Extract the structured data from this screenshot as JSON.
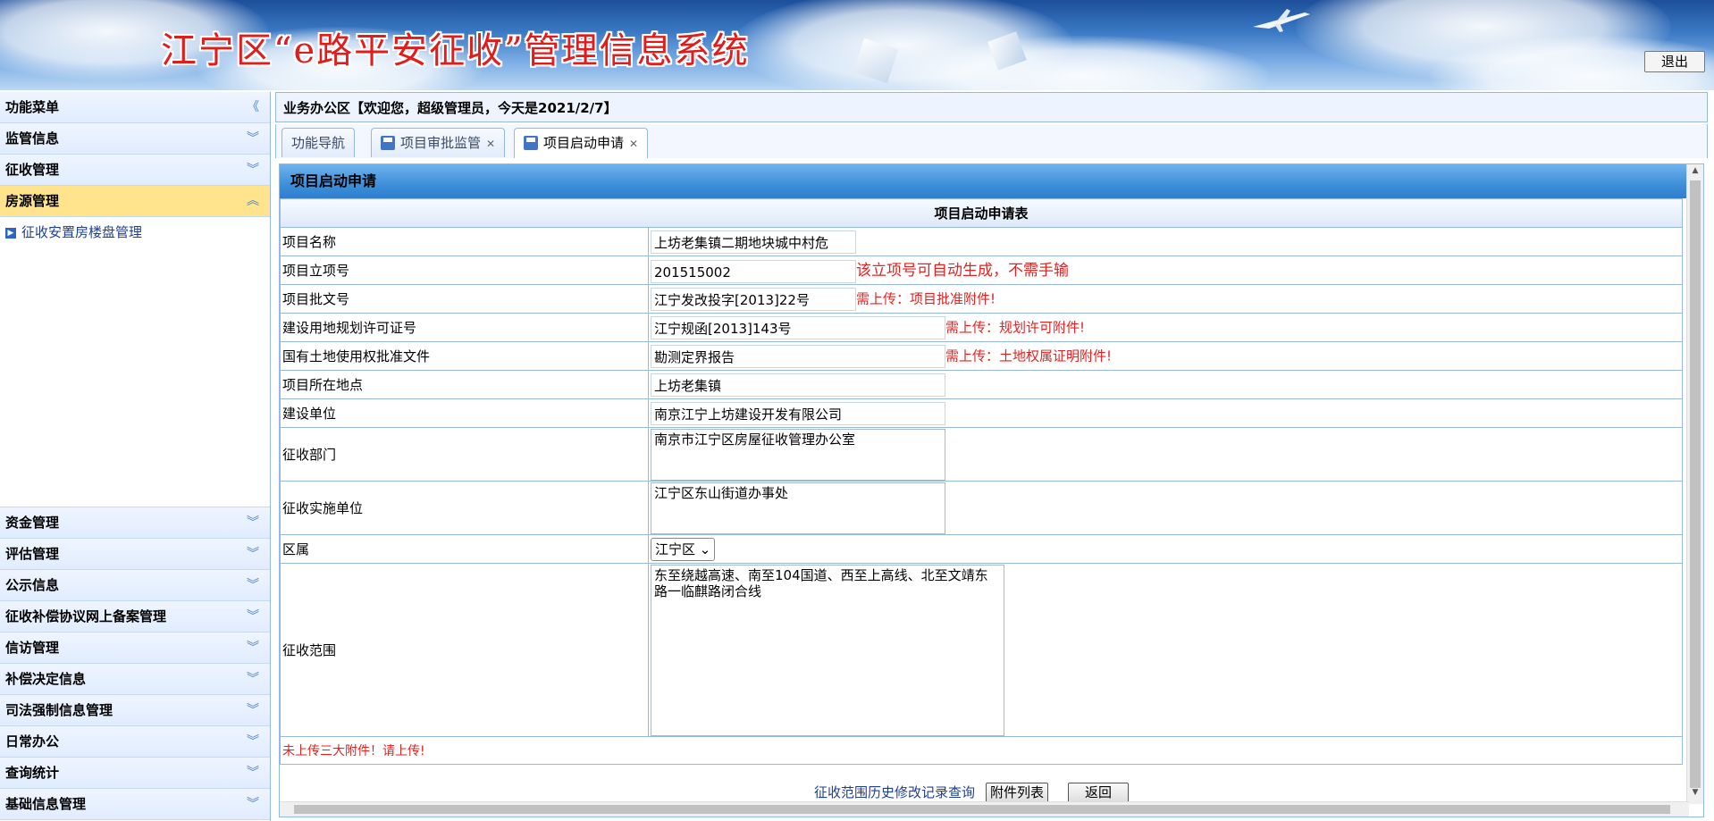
{
  "header": {
    "title": "江宁区“e路平安征收”管理信息系统",
    "logout": "退出"
  },
  "sidebar": {
    "menu_header": "功能菜单",
    "menu_header_icon": "double-chevron-left-icon",
    "sections_top": [
      "监管信息",
      "征收管理"
    ],
    "active_section": "房源管理",
    "active_item": "征收安置房楼盘管理",
    "sections_bottom": [
      "资金管理",
      "评估管理",
      "公示信息",
      "征收补偿协议网上备案管理",
      "信访管理",
      "补偿决定信息",
      "司法强制信息管理",
      "日常办公",
      "查询统计",
      "基础信息管理"
    ]
  },
  "office_bar": {
    "text": "业务办公区【欢迎您，超级管理员，今天是2021/2/7】"
  },
  "tabs": [
    {
      "label": "功能导航"
    },
    {
      "label": "项目审批监管"
    },
    {
      "label": "项目启动申请"
    }
  ],
  "panel": {
    "title": "项目启动申请",
    "form_caption": "项目启动申请表",
    "rows": {
      "project_name": {
        "label": "项目名称",
        "value": "上坊老集镇二期地块城中村危"
      },
      "project_no": {
        "label": "项目立项号",
        "value": "201515002",
        "note": "该立项号可自动生成，不需手输"
      },
      "approval_doc": {
        "label": "项目批文号",
        "value": "江宁发改投字[2013]22号",
        "note": "需上传：项目批准附件!"
      },
      "land_permit": {
        "label": "建设用地规划许可证号",
        "value": "江宁规函[2013]143号",
        "note": "需上传：规划许可附件!"
      },
      "land_use": {
        "label": "国有土地使用权批准文件",
        "value": "勘测定界报告",
        "note": "需上传：土地权属证明附件!"
      },
      "location": {
        "label": "项目所在地点",
        "value": "上坊老集镇"
      },
      "builder": {
        "label": "建设单位",
        "value": "南京江宁上坊建设开发有限公司"
      },
      "dept": {
        "label": "征收部门",
        "value": "南京市江宁区房屋征收管理办公室"
      },
      "impl_unit": {
        "label": "征收实施单位",
        "value": "江宁区东山街道办事处"
      },
      "district": {
        "label": "区属",
        "value": "江宁区"
      },
      "scope": {
        "label": "征收范围",
        "value": "东至绕越高速、南至104国道、西至上高线、北至文靖东路一临麒路闭合线"
      }
    },
    "warning": "未上传三大附件！请上传!",
    "history_link": "征收范围历史修改记录查询",
    "attachments_button": "附件列表",
    "back_button": "返回"
  }
}
